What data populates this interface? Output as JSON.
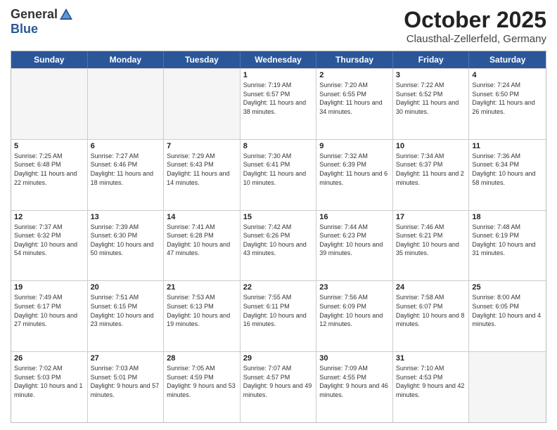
{
  "header": {
    "logo_general": "General",
    "logo_blue": "Blue",
    "month_title": "October 2025",
    "location": "Clausthal-Zellerfeld, Germany"
  },
  "weekdays": [
    "Sunday",
    "Monday",
    "Tuesday",
    "Wednesday",
    "Thursday",
    "Friday",
    "Saturday"
  ],
  "rows": [
    [
      {
        "day": "",
        "sunrise": "",
        "sunset": "",
        "daylight": "",
        "empty": true
      },
      {
        "day": "",
        "sunrise": "",
        "sunset": "",
        "daylight": "",
        "empty": true
      },
      {
        "day": "",
        "sunrise": "",
        "sunset": "",
        "daylight": "",
        "empty": true
      },
      {
        "day": "1",
        "sunrise": "Sunrise: 7:19 AM",
        "sunset": "Sunset: 6:57 PM",
        "daylight": "Daylight: 11 hours and 38 minutes.",
        "empty": false
      },
      {
        "day": "2",
        "sunrise": "Sunrise: 7:20 AM",
        "sunset": "Sunset: 6:55 PM",
        "daylight": "Daylight: 11 hours and 34 minutes.",
        "empty": false
      },
      {
        "day": "3",
        "sunrise": "Sunrise: 7:22 AM",
        "sunset": "Sunset: 6:52 PM",
        "daylight": "Daylight: 11 hours and 30 minutes.",
        "empty": false
      },
      {
        "day": "4",
        "sunrise": "Sunrise: 7:24 AM",
        "sunset": "Sunset: 6:50 PM",
        "daylight": "Daylight: 11 hours and 26 minutes.",
        "empty": false
      }
    ],
    [
      {
        "day": "5",
        "sunrise": "Sunrise: 7:25 AM",
        "sunset": "Sunset: 6:48 PM",
        "daylight": "Daylight: 11 hours and 22 minutes.",
        "empty": false
      },
      {
        "day": "6",
        "sunrise": "Sunrise: 7:27 AM",
        "sunset": "Sunset: 6:46 PM",
        "daylight": "Daylight: 11 hours and 18 minutes.",
        "empty": false
      },
      {
        "day": "7",
        "sunrise": "Sunrise: 7:29 AM",
        "sunset": "Sunset: 6:43 PM",
        "daylight": "Daylight: 11 hours and 14 minutes.",
        "empty": false
      },
      {
        "day": "8",
        "sunrise": "Sunrise: 7:30 AM",
        "sunset": "Sunset: 6:41 PM",
        "daylight": "Daylight: 11 hours and 10 minutes.",
        "empty": false
      },
      {
        "day": "9",
        "sunrise": "Sunrise: 7:32 AM",
        "sunset": "Sunset: 6:39 PM",
        "daylight": "Daylight: 11 hours and 6 minutes.",
        "empty": false
      },
      {
        "day": "10",
        "sunrise": "Sunrise: 7:34 AM",
        "sunset": "Sunset: 6:37 PM",
        "daylight": "Daylight: 11 hours and 2 minutes.",
        "empty": false
      },
      {
        "day": "11",
        "sunrise": "Sunrise: 7:36 AM",
        "sunset": "Sunset: 6:34 PM",
        "daylight": "Daylight: 10 hours and 58 minutes.",
        "empty": false
      }
    ],
    [
      {
        "day": "12",
        "sunrise": "Sunrise: 7:37 AM",
        "sunset": "Sunset: 6:32 PM",
        "daylight": "Daylight: 10 hours and 54 minutes.",
        "empty": false
      },
      {
        "day": "13",
        "sunrise": "Sunrise: 7:39 AM",
        "sunset": "Sunset: 6:30 PM",
        "daylight": "Daylight: 10 hours and 50 minutes.",
        "empty": false
      },
      {
        "day": "14",
        "sunrise": "Sunrise: 7:41 AM",
        "sunset": "Sunset: 6:28 PM",
        "daylight": "Daylight: 10 hours and 47 minutes.",
        "empty": false
      },
      {
        "day": "15",
        "sunrise": "Sunrise: 7:42 AM",
        "sunset": "Sunset: 6:26 PM",
        "daylight": "Daylight: 10 hours and 43 minutes.",
        "empty": false
      },
      {
        "day": "16",
        "sunrise": "Sunrise: 7:44 AM",
        "sunset": "Sunset: 6:23 PM",
        "daylight": "Daylight: 10 hours and 39 minutes.",
        "empty": false
      },
      {
        "day": "17",
        "sunrise": "Sunrise: 7:46 AM",
        "sunset": "Sunset: 6:21 PM",
        "daylight": "Daylight: 10 hours and 35 minutes.",
        "empty": false
      },
      {
        "day": "18",
        "sunrise": "Sunrise: 7:48 AM",
        "sunset": "Sunset: 6:19 PM",
        "daylight": "Daylight: 10 hours and 31 minutes.",
        "empty": false
      }
    ],
    [
      {
        "day": "19",
        "sunrise": "Sunrise: 7:49 AM",
        "sunset": "Sunset: 6:17 PM",
        "daylight": "Daylight: 10 hours and 27 minutes.",
        "empty": false
      },
      {
        "day": "20",
        "sunrise": "Sunrise: 7:51 AM",
        "sunset": "Sunset: 6:15 PM",
        "daylight": "Daylight: 10 hours and 23 minutes.",
        "empty": false
      },
      {
        "day": "21",
        "sunrise": "Sunrise: 7:53 AM",
        "sunset": "Sunset: 6:13 PM",
        "daylight": "Daylight: 10 hours and 19 minutes.",
        "empty": false
      },
      {
        "day": "22",
        "sunrise": "Sunrise: 7:55 AM",
        "sunset": "Sunset: 6:11 PM",
        "daylight": "Daylight: 10 hours and 16 minutes.",
        "empty": false
      },
      {
        "day": "23",
        "sunrise": "Sunrise: 7:56 AM",
        "sunset": "Sunset: 6:09 PM",
        "daylight": "Daylight: 10 hours and 12 minutes.",
        "empty": false
      },
      {
        "day": "24",
        "sunrise": "Sunrise: 7:58 AM",
        "sunset": "Sunset: 6:07 PM",
        "daylight": "Daylight: 10 hours and 8 minutes.",
        "empty": false
      },
      {
        "day": "25",
        "sunrise": "Sunrise: 8:00 AM",
        "sunset": "Sunset: 6:05 PM",
        "daylight": "Daylight: 10 hours and 4 minutes.",
        "empty": false
      }
    ],
    [
      {
        "day": "26",
        "sunrise": "Sunrise: 7:02 AM",
        "sunset": "Sunset: 5:03 PM",
        "daylight": "Daylight: 10 hours and 1 minute.",
        "empty": false
      },
      {
        "day": "27",
        "sunrise": "Sunrise: 7:03 AM",
        "sunset": "Sunset: 5:01 PM",
        "daylight": "Daylight: 9 hours and 57 minutes.",
        "empty": false
      },
      {
        "day": "28",
        "sunrise": "Sunrise: 7:05 AM",
        "sunset": "Sunset: 4:59 PM",
        "daylight": "Daylight: 9 hours and 53 minutes.",
        "empty": false
      },
      {
        "day": "29",
        "sunrise": "Sunrise: 7:07 AM",
        "sunset": "Sunset: 4:57 PM",
        "daylight": "Daylight: 9 hours and 49 minutes.",
        "empty": false
      },
      {
        "day": "30",
        "sunrise": "Sunrise: 7:09 AM",
        "sunset": "Sunset: 4:55 PM",
        "daylight": "Daylight: 9 hours and 46 minutes.",
        "empty": false
      },
      {
        "day": "31",
        "sunrise": "Sunrise: 7:10 AM",
        "sunset": "Sunset: 4:53 PM",
        "daylight": "Daylight: 9 hours and 42 minutes.",
        "empty": false
      },
      {
        "day": "",
        "sunrise": "",
        "sunset": "",
        "daylight": "",
        "empty": true
      }
    ]
  ]
}
